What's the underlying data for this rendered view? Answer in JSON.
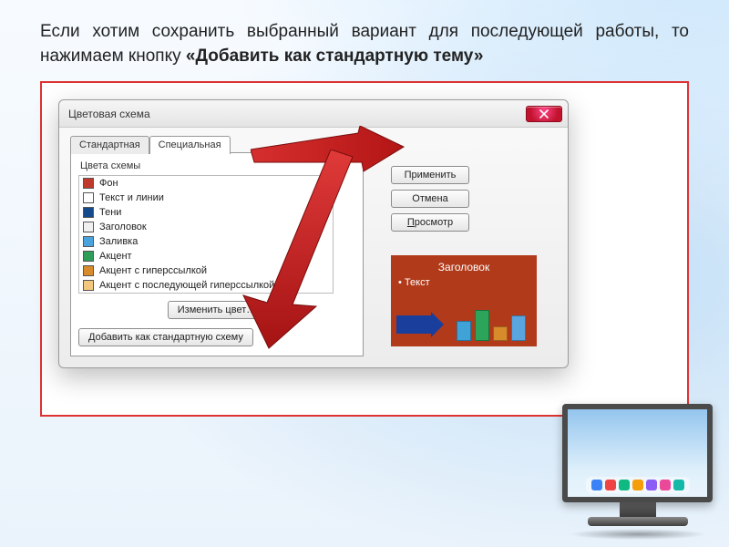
{
  "caption": {
    "pre": "Если хотим сохранить выбранный вариант для последующей работы, то нажимаем кнопку ",
    "bold": "«Добавить как стандартную тему»"
  },
  "dialog": {
    "title": "Цветовая схема",
    "tabs": {
      "standard": "Стандартная",
      "special": "Специальная"
    },
    "group_label": "Цвета схемы",
    "scheme": [
      {
        "color": "#c0392b",
        "label": "Фон"
      },
      {
        "color": "#ffffff",
        "label": "Текст и линии"
      },
      {
        "color": "#154b8c",
        "label": "Тени"
      },
      {
        "color": "#f0f0f0",
        "label": "Заголовок"
      },
      {
        "color": "#4aa3dd",
        "label": "Заливка"
      },
      {
        "color": "#2f9e58",
        "label": "Акцент"
      },
      {
        "color": "#d88b2a",
        "label": "Акцент с гиперссылкой"
      },
      {
        "color": "#f3c77c",
        "label": "Акцент с последующей гиперссылкой"
      }
    ],
    "change_color": "Изменить цвет…",
    "add_standard": "Добавить как стандартную схему",
    "side": {
      "apply": "Применить",
      "cancel": "Отмена",
      "preview_btn_pre": "П",
      "preview_btn_rest": "росмотр"
    },
    "preview": {
      "title": "Заголовок",
      "bullet": "• Текст"
    }
  },
  "dock_colors": [
    "#3b82f6",
    "#ef4444",
    "#10b981",
    "#f59e0b",
    "#8b5cf6",
    "#ec4899",
    "#14b8a6"
  ]
}
